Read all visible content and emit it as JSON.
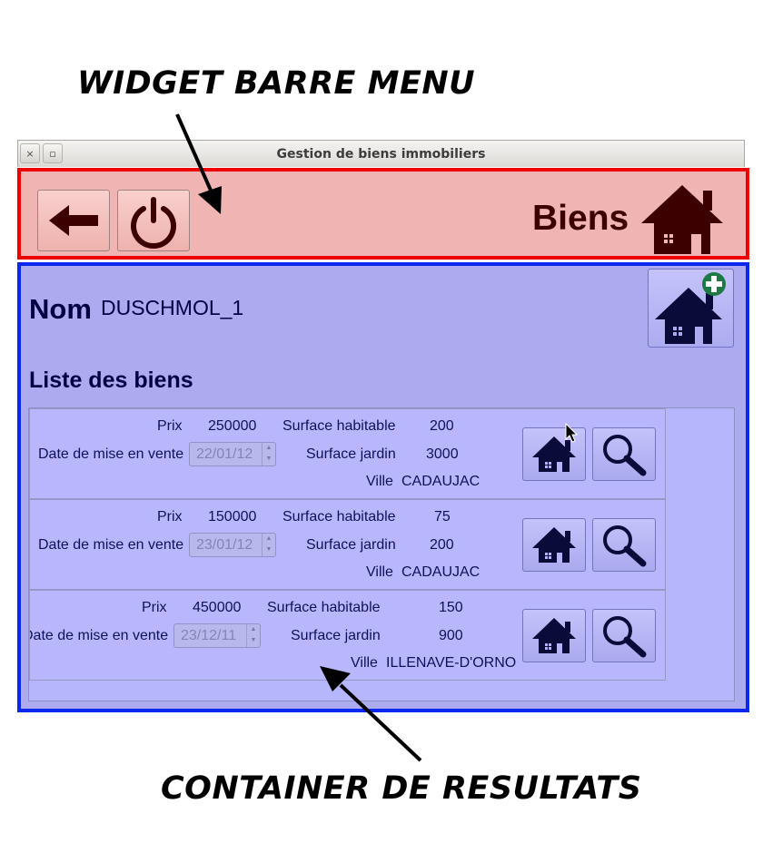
{
  "annotations": {
    "top": "WIDGET BARRE MENU",
    "bottom": "CONTAINER DE RESULTATS"
  },
  "window": {
    "title": "Gestion de biens immobiliers",
    "close_glyph": "×",
    "maximize_glyph": "▫"
  },
  "menubar": {
    "title": "Biens",
    "back_icon": "arrow-left-icon",
    "power_icon": "power-icon",
    "house_icon": "house-icon"
  },
  "owner": {
    "label": "Nom",
    "value": "DUSCHMOL_1"
  },
  "list": {
    "title": "Liste des biens",
    "labels": {
      "prix": "Prix",
      "surface_habitable": "Surface habitable",
      "date": "Date de mise en vente",
      "surface_jardin": "Surface jardin",
      "ville": "Ville"
    },
    "rows": [
      {
        "prix": "250000",
        "surface_habitable": "200",
        "date": "22/01/12",
        "surface_jardin": "3000",
        "ville": "CADAUJAC"
      },
      {
        "prix": "150000",
        "surface_habitable": "75",
        "date": "23/01/12",
        "surface_jardin": "200",
        "ville": "CADAUJAC"
      },
      {
        "prix": "450000",
        "surface_habitable": "150",
        "date": "23/12/11",
        "surface_jardin": "900",
        "ville": "ILLENAVE-D'ORNO"
      }
    ]
  },
  "colors": {
    "menubar_bg": "#f0b5b2",
    "menubar_border": "#ef0000",
    "results_bg": "#adabf0",
    "results_border": "#0a28ee",
    "icon_dark": "#3d0000",
    "icon_navy": "#0b0b3a",
    "add_badge": "#1e7a45"
  }
}
